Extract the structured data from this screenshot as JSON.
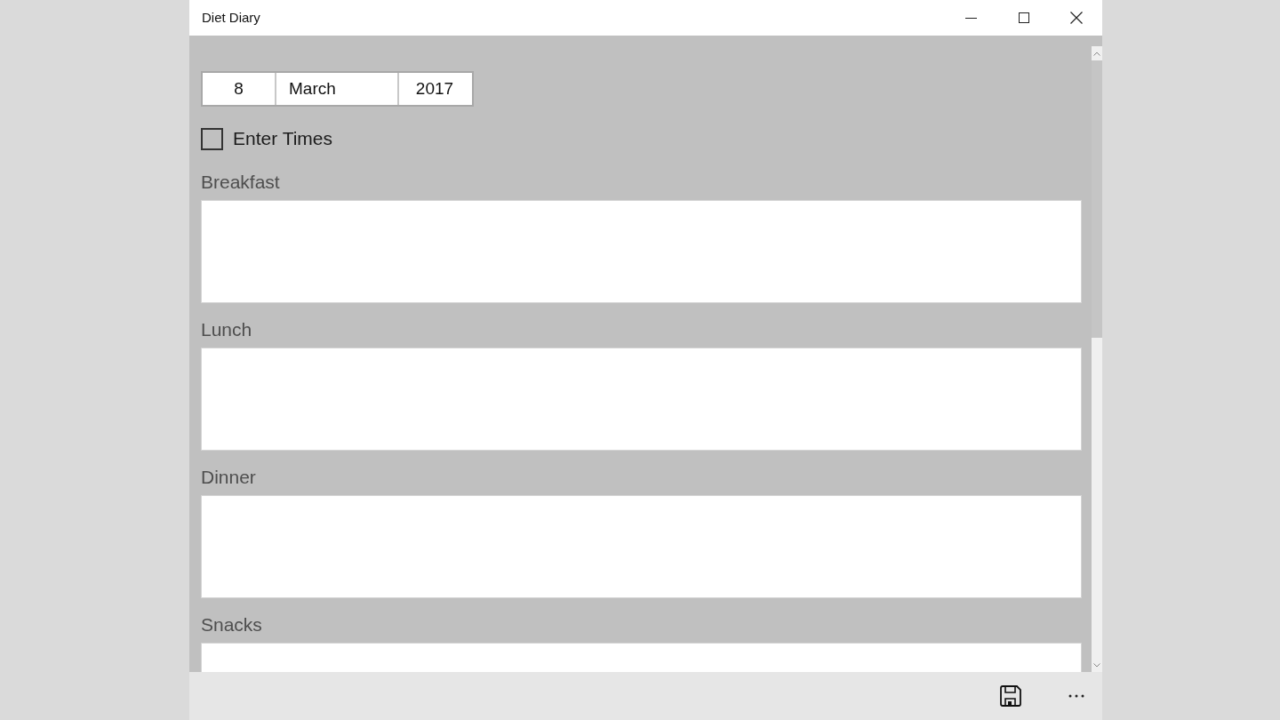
{
  "window": {
    "title": "Diet Diary"
  },
  "date": {
    "day": "8",
    "month": "March",
    "year": "2017"
  },
  "enter_times": {
    "label": "Enter Times",
    "checked": false
  },
  "meals": [
    {
      "label": "Breakfast"
    },
    {
      "label": "Lunch"
    },
    {
      "label": "Dinner"
    },
    {
      "label": "Snacks"
    }
  ]
}
